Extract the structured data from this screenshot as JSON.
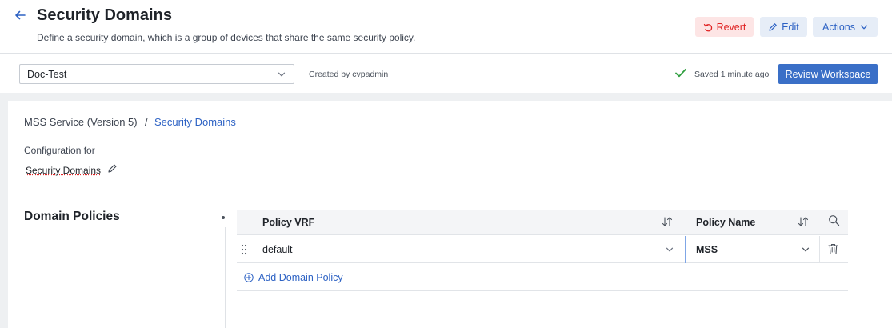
{
  "header": {
    "title": "Security Domains",
    "subtitle": "Define a security domain, which is a group of devices that share the same security policy.",
    "revert_label": "Revert",
    "edit_label": "Edit",
    "actions_label": "Actions"
  },
  "workspace": {
    "selected": "Doc-Test",
    "created_by": "Created by cvpadmin",
    "saved_status": "Saved 1 minute ago",
    "review_label": "Review Workspace"
  },
  "breadcrumb": {
    "root": "MSS Service (Version 5)",
    "separator": "/",
    "current": "Security Domains"
  },
  "config": {
    "label": "Configuration for",
    "value": "Security Domains"
  },
  "domain_policies": {
    "title": "Domain Policies",
    "columns": [
      "Policy VRF",
      "Policy Name"
    ],
    "rows": [
      {
        "policy_vrf": "default",
        "policy_name": "MSS"
      }
    ],
    "add_label": "Add Domain Policy"
  },
  "colors": {
    "accent": "#3a6fc7",
    "link": "#2d62c4",
    "revert": "#e02424",
    "revert_bg": "#fde5e5",
    "success": "#2e9e3e"
  },
  "icons": [
    "back-arrow-icon",
    "undo-icon",
    "pencil-icon",
    "chevron-down-icon",
    "check-icon",
    "sort-icon",
    "search-icon",
    "drag-handle-icon",
    "trash-icon",
    "plus-circle-icon"
  ]
}
